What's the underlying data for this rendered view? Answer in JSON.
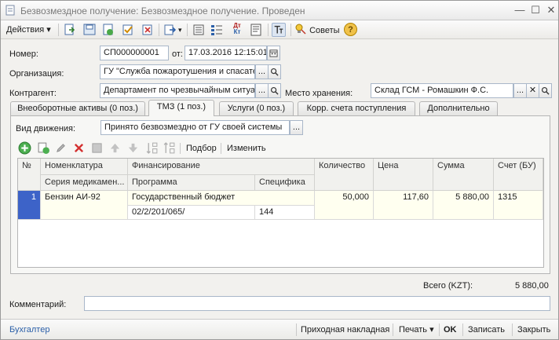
{
  "window": {
    "title": "Безвозмездное получение: Безвозмездное получение. Проведен",
    "controls": {
      "minimize": "—",
      "maximize": "☐",
      "close": "✕"
    }
  },
  "toolbar": {
    "actions_label": "Действия",
    "dropdown_arrow": "▾",
    "advice_label": "Советы",
    "help_glyph": "?",
    "dtkt_top": "Дт",
    "dtkt_bottom": "Кт"
  },
  "form": {
    "number_label": "Номер:",
    "number_value": "СП000000001",
    "date_label": "от:",
    "date_value": "17.03.2016 12:15:01",
    "org_label": "Организация:",
    "org_value": "ГУ \"Служба пожаротушения и спасате",
    "counterparty_label": "Контрагент:",
    "counterparty_value": "Департамент по чрезвычайным ситуа",
    "storage_label": "Место хранения:",
    "storage_value": "Склад ГСМ - Ромашкин Ф.С.",
    "select_button": "...",
    "clear_button": "✕"
  },
  "tabs": [
    {
      "label": "Внеоборотные активы (0 поз.)"
    },
    {
      "label": "ТМЗ (1 поз.)"
    },
    {
      "label": "Услуги (0 поз.)"
    },
    {
      "label": "Корр. счета поступления"
    },
    {
      "label": "Дополнительно"
    }
  ],
  "tmz": {
    "movement_label": "Вид движения:",
    "movement_value": "Принято безвозмездно от ГУ своей системы",
    "selection_label": "Подбор",
    "edit_label": "Изменить"
  },
  "grid": {
    "headers": {
      "n": "№",
      "nomenclature": "Номенклатура",
      "financing": "Финансирование",
      "quantity": "Количество",
      "price": "Цена",
      "sum": "Сумма",
      "account": "Счет (БУ)",
      "series": "Серия медикамен...",
      "program": "Программа",
      "specifics": "Специфика"
    },
    "rows": [
      {
        "n": "1",
        "nomenclature": "Бензин АИ-92",
        "financing": "Государственный бюджет",
        "program": "02/2/201/065/",
        "specifics": "144",
        "quantity": "50,000",
        "price": "117,60",
        "sum": "5 880,00",
        "account": "1315"
      }
    ]
  },
  "totals": {
    "label": "Всего (KZT):",
    "value": "5 880,00"
  },
  "comment": {
    "label": "Комментарий:",
    "value": ""
  },
  "bottom": {
    "accountant": "Бухгалтер",
    "invoice": "Приходная накладная",
    "print": "Печать",
    "ok": "OK",
    "save": "Записать",
    "close": "Закрыть"
  },
  "colors": {
    "accent": "#2b5fa8",
    "selected_row_marker": "#3d63c8",
    "field_border": "#a9b7c9"
  }
}
